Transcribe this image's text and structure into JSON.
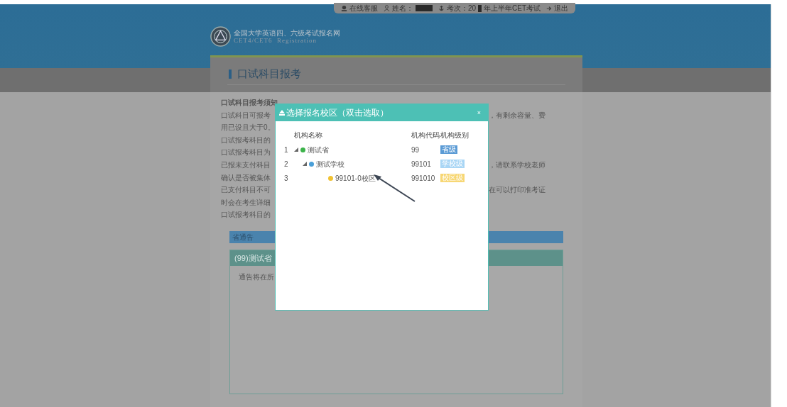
{
  "top_bar": {
    "items": [
      {
        "kind": "service",
        "label": "在线客服"
      },
      {
        "kind": "user",
        "label": "姓名："
      },
      {
        "kind": "exam",
        "label": "考次：20",
        "label_after": "年上半年CET考试"
      },
      {
        "kind": "logout",
        "label": "退出"
      }
    ]
  },
  "site": {
    "title": "全国大学英语四、六级考试报名网",
    "subtitle": "CET4/CET6  Registration"
  },
  "page_title": "口试科目报考",
  "notes": [
    {
      "left": "口试科目报考须知"
    },
    {
      "left": "口试科目可报考",
      "right": "，有剩余容量、费"
    },
    {
      "left": "用已设且大于0。"
    },
    {
      "left": "口试报考科目的"
    },
    {
      "left": "口试报考科目为"
    },
    {
      "left": "已报未支付科目",
      "right": "，请联系学校老师"
    },
    {
      "left": "确认是否被集体"
    },
    {
      "left": "已支付科目不可",
      "right": "在可以打印准考证"
    },
    {
      "left": "时会在考生详细"
    },
    {
      "left": "口试报考科目的"
    }
  ],
  "notice_bar": "省通告",
  "notice_panel": {
    "title": "(99)测试省",
    "body": "通告将在所"
  },
  "dialog": {
    "title": "选择报名校区（双击选取）",
    "close": "×",
    "columns": [
      "机构名称",
      "机构代码",
      "机构级别"
    ],
    "rows": [
      {
        "no": "1",
        "kind": "province",
        "name": "测试省",
        "code": "99",
        "level": "省级",
        "color": "#5b9bd5",
        "expanded": true,
        "children": [
          {
            "no": "2",
            "kind": "school",
            "name": "测试学校",
            "code": "99101",
            "level": "学校级",
            "color": "#a9d6f5",
            "expanded": true,
            "children": [
              {
                "no": "3",
                "kind": "campus",
                "name": "99101-0校区",
                "code": "991010",
                "level": "校区级",
                "color": "#f7d774"
              }
            ]
          }
        ]
      }
    ]
  }
}
